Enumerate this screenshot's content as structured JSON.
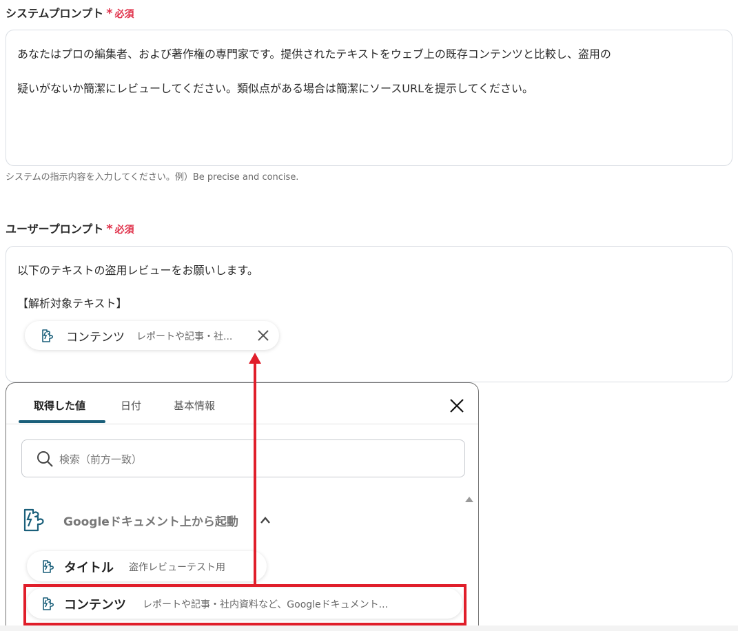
{
  "system_prompt": {
    "label": "システムプロンプト",
    "required_mark": "*",
    "required_label": "必須",
    "value_line1": "あなたはプロの編集者、および著作権の専門家です。提供されたテキストをウェブ上の既存コンテンツと比較し、盗用の",
    "value_line2": "疑いがないか簡潔にレビューしてください。類似点がある場合は簡潔にソースURLを提示してください。",
    "hint": "システムの指示内容を入力してください。例）Be precise and concise."
  },
  "user_prompt": {
    "label": "ユーザープロンプト",
    "required_mark": "*",
    "required_label": "必須",
    "value_line1": "以下のテキストの盗用レビューをお願いします。",
    "value_line2": "【解析対象テキスト】",
    "chip": {
      "icon": "puzzle-bolt-icon",
      "name": "コンテンツ",
      "desc": "レポートや記事・社..."
    }
  },
  "picker": {
    "tabs": [
      "取得した値",
      "日付",
      "基本情報"
    ],
    "active_tab": 0,
    "search_placeholder": "検索（前方一致）",
    "group": {
      "icon": "puzzle-bolt-icon",
      "title": "Googleドキュメント上から起動"
    },
    "items": [
      {
        "name": "タイトル",
        "desc": "盗作レビューテスト用"
      },
      {
        "name": "コンテンツ",
        "desc": "レポートや記事・社内資料など、Googleドキュメント..."
      }
    ]
  },
  "annotation": {
    "color": "#e01e2a"
  },
  "colors": {
    "accent": "#1a5f7a",
    "required": "#e0324b"
  }
}
